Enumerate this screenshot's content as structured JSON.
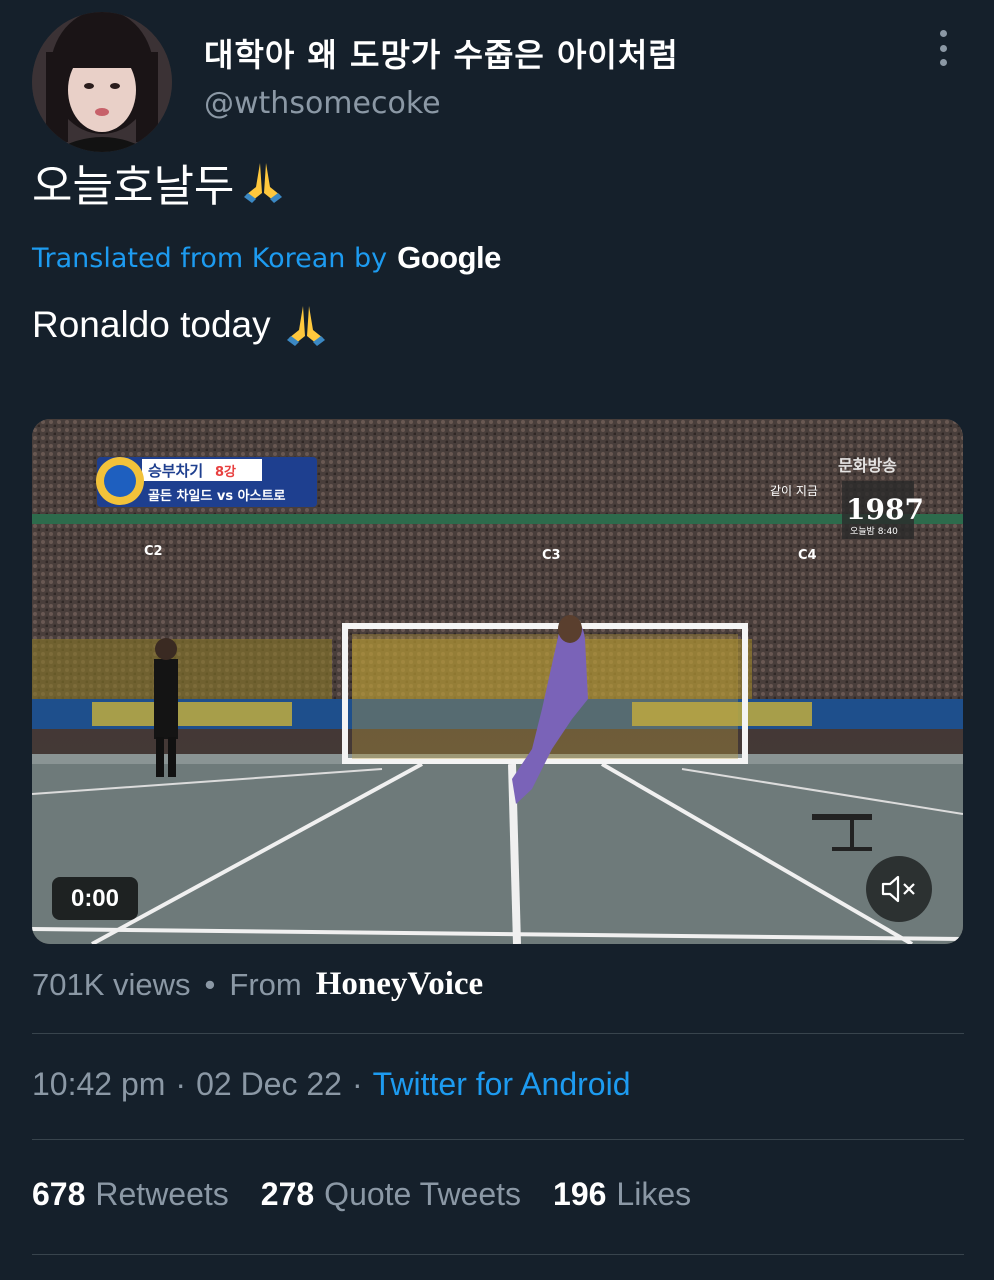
{
  "tweet": {
    "author": {
      "display_name": "대학아 왜 도망가 수줍은 아이처럼",
      "handle": "@wthsomecoke"
    },
    "text": "오늘호날두",
    "translation_label": "Translated from Korean by",
    "translation_provider": "Google",
    "translated_text": "Ronaldo today",
    "emoji": "folded-hands-emoji"
  },
  "video": {
    "timestamp": "0:00",
    "overlay": {
      "match_label": "승부차기",
      "round": "8강",
      "teams": "골든 차일드 vs 아스트로",
      "channel": "문화방송",
      "promo_number": "1987",
      "promo_time": "오늘밤 8:40",
      "section_labels": [
        "C2",
        "C3",
        "C4"
      ],
      "banner": "같이 지금"
    }
  },
  "views": {
    "count": "701K views",
    "separator": "•",
    "from_label": "From",
    "brand": "HoneyVoice"
  },
  "meta": {
    "time": "10:42 pm",
    "sep1": "·",
    "date": "02 Dec 22",
    "sep2": "·",
    "source": "Twitter for Android"
  },
  "stats": {
    "retweets": {
      "count": "678",
      "label": "Retweets"
    },
    "quotes": {
      "count": "278",
      "label": "Quote Tweets"
    },
    "likes": {
      "count": "196",
      "label": "Likes"
    }
  },
  "colors": {
    "background": "#15202b",
    "link": "#1d9bf0",
    "muted": "#8b98a5",
    "divider": "#38444d"
  }
}
